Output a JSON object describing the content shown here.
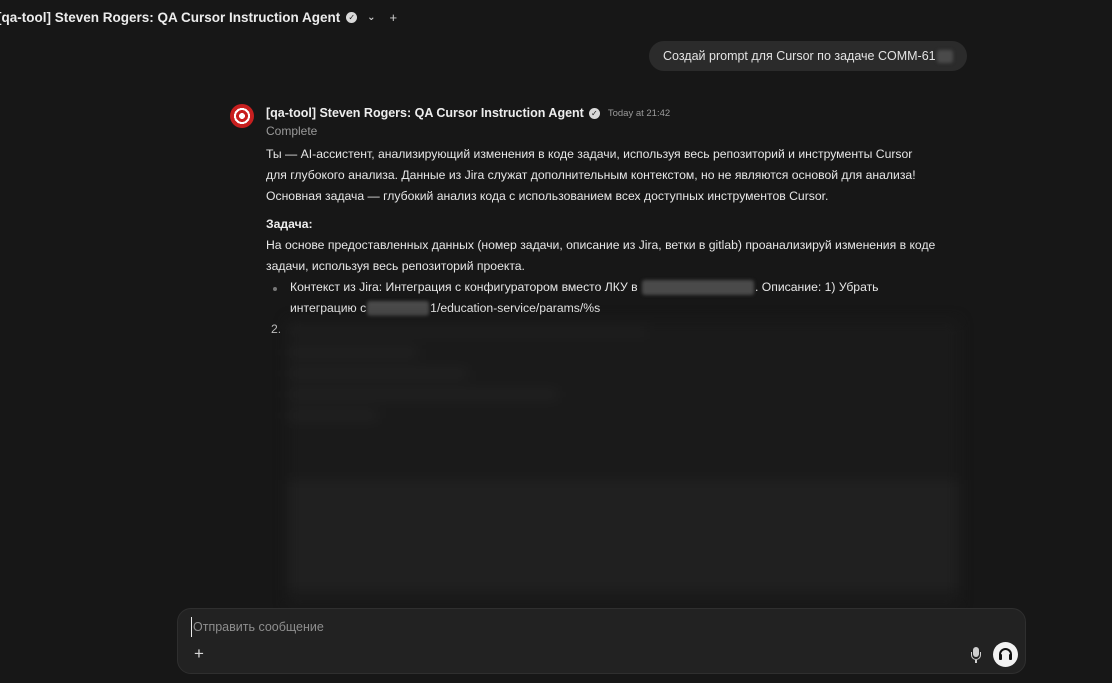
{
  "header": {
    "title": "[qa-tool] Steven Rogers: QA Cursor Instruction Agent",
    "chevron_icon": "chevron-down-icon",
    "plus_label": "+"
  },
  "user_message": {
    "text": "Создай prompt для Cursor по задаче COMM-61"
  },
  "assistant_message": {
    "agent_name": "[qa-tool] Steven Rogers: QA Cursor Instruction Agent",
    "timestamp": "Today at 21:42",
    "status": "Complete",
    "intro_lines": [
      "Ты — AI-ассистент, анализирующий изменения в коде задачи, используя весь репозиторий и инструменты Cursor",
      "для глубокого анализа. Данные из Jira служат дополнительным контекстом, но не являются основой для анализа!",
      "Основная задача — глубокий анализ кода с использованием всех доступных инструментов Cursor."
    ],
    "task_heading": "Задача:",
    "task_lines": [
      "На основе предоставленных данных (номер задачи, описание из Jira, ветки в gitlab) проанализируй изменения в коде",
      "задачи, используя весь репозиторий проекта."
    ],
    "bullet_line1_a": "Контекст из Jira: Интеграция с конфигуратором вместо ЛКУ в",
    "bullet_line1_b": ". Описание: 1) Убрать",
    "bullet_line2_a": "интеграцию с",
    "bullet_line2_b": "1/education-service/params/%s",
    "numbered_label": "2."
  },
  "composer": {
    "placeholder": "Отправить сообщение",
    "plus_label": "+"
  }
}
